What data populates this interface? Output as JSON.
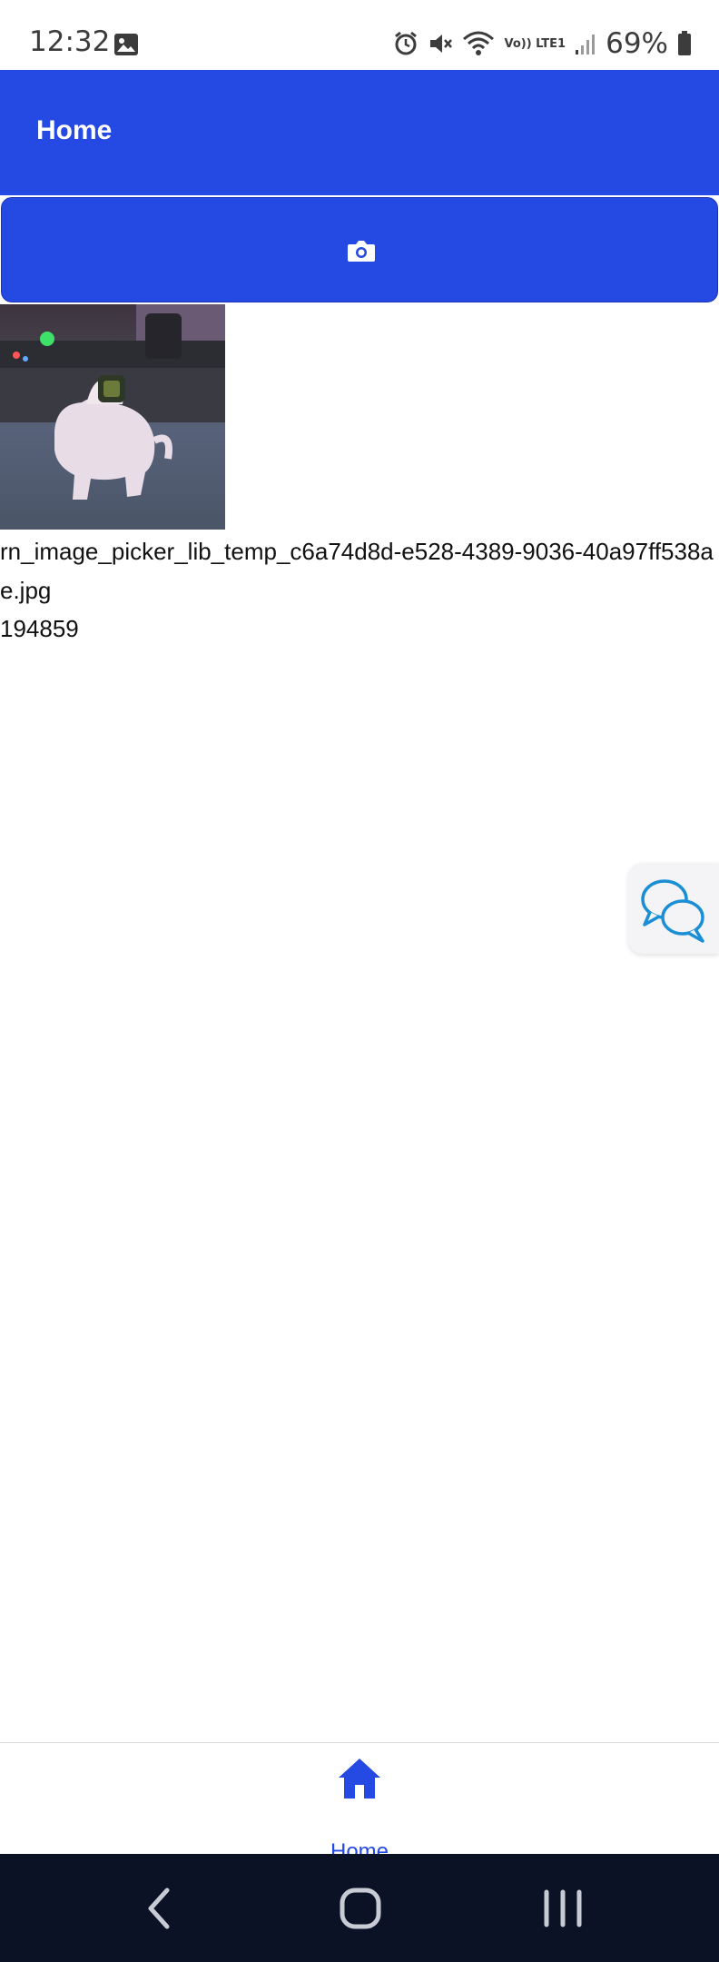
{
  "status_bar": {
    "time": "12:32",
    "network_label": "Vo)) LTE1",
    "battery": "69%"
  },
  "header": {
    "title": "Home"
  },
  "toolbar": {
    "camera_icon": "camera-icon"
  },
  "picked_file": {
    "name": "rn_image_picker_lib_temp_c6a74d8d-e528-4389-9036-40a97ff538ae.jpg",
    "size": "194859"
  },
  "tabs": [
    {
      "label": "Home",
      "icon": "home-icon",
      "active": true
    }
  ],
  "colors": {
    "primary": "#2549e3",
    "chat_icon": "#1a8fd6",
    "nav_bar": "#0c1226"
  }
}
